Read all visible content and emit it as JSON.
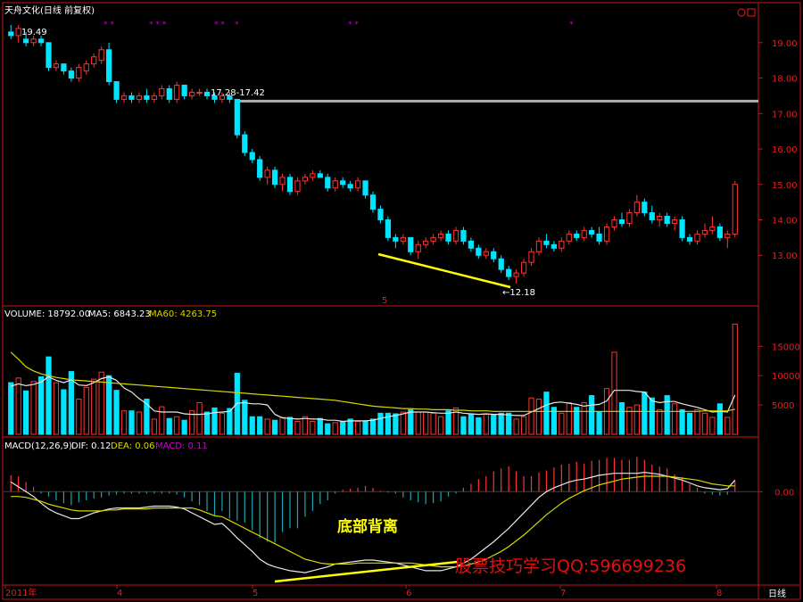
{
  "window": {
    "title": "天舟文化(日线 前复权)",
    "period_button": "日线",
    "zoom_icon": "circle-icon"
  },
  "colors": {
    "up": "#ff3333",
    "down": "#00e5ff",
    "frame": "#c81414",
    "ma_yellow": "#d8d800",
    "ma_white": "#e8e8e8",
    "highlight": "#ffff00",
    "macd_label": "#d000d0",
    "watermark": "#e01010"
  },
  "price_panel": {
    "high_note": "19.49",
    "range_note": "17.28-17.42",
    "low_note": "←12.18",
    "marker_5": "5"
  },
  "volume_panel": {
    "label": "VOLUME: 18792.00",
    "ma5": "MA5: 6843.23",
    "ma60": "MA60: 4263.75"
  },
  "macd_panel": {
    "label": "MACD(12,26,9)",
    "dif": "DIF: 0.12",
    "dea": "DEA: 0.06",
    "macd": "MACD: 0.11"
  },
  "annotations": {
    "divergence": "底部背离",
    "watermark": "股票技巧学习QQ:596699236"
  },
  "x_axis_labels": [
    "2011年",
    "4",
    "5",
    "6",
    "7",
    "8"
  ],
  "chart_data": [
    {
      "type": "candlestick",
      "name": "price",
      "y_ticks": [
        13.0,
        14.0,
        15.0,
        16.0,
        17.0,
        18.0,
        19.0
      ],
      "ylim": [
        12.1,
        19.7
      ],
      "resistance": 17.35,
      "ohlc": [
        [
          19.3,
          19.5,
          19.1,
          19.2
        ],
        [
          19.2,
          19.5,
          19.0,
          19.4
        ],
        [
          19.1,
          19.3,
          18.9,
          19.0
        ],
        [
          19.0,
          19.2,
          18.9,
          19.1
        ],
        [
          19.1,
          19.2,
          18.9,
          19.0
        ],
        [
          19.0,
          19.0,
          18.2,
          18.3
        ],
        [
          18.3,
          18.5,
          18.2,
          18.4
        ],
        [
          18.4,
          18.4,
          18.1,
          18.2
        ],
        [
          18.2,
          18.3,
          17.9,
          18.0
        ],
        [
          18.0,
          18.4,
          17.9,
          18.3
        ],
        [
          18.2,
          18.5,
          18.1,
          18.4
        ],
        [
          18.4,
          18.7,
          18.3,
          18.6
        ],
        [
          18.5,
          18.9,
          18.4,
          18.8
        ],
        [
          18.8,
          19.0,
          17.8,
          17.9
        ],
        [
          17.9,
          17.9,
          17.3,
          17.4
        ],
        [
          17.4,
          17.6,
          17.3,
          17.5
        ],
        [
          17.5,
          17.6,
          17.3,
          17.4
        ],
        [
          17.4,
          17.6,
          17.3,
          17.5
        ],
        [
          17.5,
          17.7,
          17.3,
          17.4
        ],
        [
          17.4,
          17.6,
          17.3,
          17.5
        ],
        [
          17.5,
          17.8,
          17.4,
          17.7
        ],
        [
          17.7,
          17.8,
          17.3,
          17.4
        ],
        [
          17.4,
          17.9,
          17.3,
          17.8
        ],
        [
          17.8,
          17.8,
          17.4,
          17.5
        ],
        [
          17.5,
          17.7,
          17.4,
          17.6
        ],
        [
          17.6,
          17.7,
          17.5,
          17.6
        ],
        [
          17.6,
          17.7,
          17.4,
          17.5
        ],
        [
          17.5,
          17.6,
          17.3,
          17.4
        ],
        [
          17.4,
          17.6,
          17.3,
          17.5
        ],
        [
          17.5,
          17.6,
          17.3,
          17.4
        ],
        [
          17.4,
          17.4,
          16.3,
          16.4
        ],
        [
          16.4,
          16.5,
          15.8,
          15.9
        ],
        [
          15.9,
          16.0,
          15.6,
          15.7
        ],
        [
          15.7,
          15.8,
          15.1,
          15.2
        ],
        [
          15.2,
          15.5,
          15.0,
          15.4
        ],
        [
          15.4,
          15.5,
          14.9,
          15.0
        ],
        [
          15.0,
          15.3,
          14.8,
          15.2
        ],
        [
          15.2,
          15.3,
          14.7,
          14.8
        ],
        [
          14.8,
          15.2,
          14.7,
          15.1
        ],
        [
          15.1,
          15.3,
          15.0,
          15.2
        ],
        [
          15.2,
          15.4,
          15.1,
          15.3
        ],
        [
          15.3,
          15.4,
          15.2,
          15.2
        ],
        [
          15.2,
          15.3,
          14.8,
          14.9
        ],
        [
          14.9,
          15.2,
          14.8,
          15.1
        ],
        [
          15.1,
          15.2,
          14.9,
          15.0
        ],
        [
          15.0,
          15.1,
          14.8,
          14.9
        ],
        [
          14.9,
          15.2,
          14.8,
          15.1
        ],
        [
          15.1,
          15.1,
          14.6,
          14.7
        ],
        [
          14.7,
          14.8,
          14.2,
          14.3
        ],
        [
          14.3,
          14.4,
          13.9,
          14.0
        ],
        [
          14.0,
          14.1,
          13.4,
          13.5
        ],
        [
          13.5,
          13.6,
          13.2,
          13.4
        ],
        [
          13.4,
          13.6,
          13.3,
          13.5
        ],
        [
          13.5,
          13.5,
          13.0,
          13.1
        ],
        [
          13.1,
          13.4,
          12.9,
          13.3
        ],
        [
          13.3,
          13.5,
          13.2,
          13.4
        ],
        [
          13.4,
          13.6,
          13.3,
          13.5
        ],
        [
          13.5,
          13.7,
          13.4,
          13.6
        ],
        [
          13.6,
          13.7,
          13.3,
          13.4
        ],
        [
          13.4,
          13.8,
          13.3,
          13.7
        ],
        [
          13.7,
          13.8,
          13.3,
          13.4
        ],
        [
          13.4,
          13.5,
          13.1,
          13.2
        ],
        [
          13.2,
          13.3,
          12.9,
          13.0
        ],
        [
          13.0,
          13.2,
          12.9,
          13.1
        ],
        [
          13.1,
          13.2,
          12.8,
          12.9
        ],
        [
          12.9,
          13.0,
          12.5,
          12.6
        ],
        [
          12.6,
          12.7,
          12.3,
          12.4
        ],
        [
          12.4,
          12.6,
          12.2,
          12.5
        ],
        [
          12.5,
          12.9,
          12.4,
          12.8
        ],
        [
          12.8,
          13.2,
          12.7,
          13.1
        ],
        [
          13.1,
          13.5,
          13.0,
          13.4
        ],
        [
          13.4,
          13.6,
          13.2,
          13.3
        ],
        [
          13.3,
          13.4,
          13.1,
          13.2
        ],
        [
          13.2,
          13.5,
          13.1,
          13.4
        ],
        [
          13.4,
          13.7,
          13.3,
          13.6
        ],
        [
          13.6,
          13.7,
          13.4,
          13.5
        ],
        [
          13.5,
          13.8,
          13.4,
          13.7
        ],
        [
          13.7,
          13.8,
          13.5,
          13.6
        ],
        [
          13.6,
          13.8,
          13.3,
          13.4
        ],
        [
          13.4,
          13.9,
          13.3,
          13.8
        ],
        [
          13.8,
          14.1,
          13.7,
          14.0
        ],
        [
          14.0,
          14.2,
          13.8,
          13.9
        ],
        [
          13.9,
          14.3,
          13.8,
          14.2
        ],
        [
          14.2,
          14.7,
          14.1,
          14.5
        ],
        [
          14.5,
          14.6,
          14.1,
          14.2
        ],
        [
          14.2,
          14.4,
          13.9,
          14.0
        ],
        [
          14.0,
          14.2,
          13.8,
          14.1
        ],
        [
          14.1,
          14.2,
          13.8,
          13.9
        ],
        [
          13.9,
          14.1,
          13.7,
          14.0
        ],
        [
          14.0,
          14.1,
          13.4,
          13.5
        ],
        [
          13.5,
          13.6,
          13.3,
          13.4
        ],
        [
          13.4,
          13.7,
          13.3,
          13.6
        ],
        [
          13.6,
          13.9,
          13.5,
          13.7
        ],
        [
          13.7,
          14.1,
          13.6,
          13.8
        ],
        [
          13.8,
          13.9,
          13.4,
          13.5
        ],
        [
          13.5,
          13.7,
          13.2,
          13.6
        ],
        [
          13.6,
          15.1,
          13.5,
          15.0
        ]
      ]
    },
    {
      "type": "bar",
      "name": "volume",
      "y_ticks": [
        5000,
        10000,
        15000
      ],
      "ylim": [
        0,
        19000
      ],
      "values": [
        8800,
        9600,
        7400,
        9000,
        9800,
        13200,
        8800,
        7600,
        10700,
        6000,
        8000,
        9400,
        10600,
        10000,
        7500,
        4000,
        4000,
        3800,
        6000,
        2600,
        4700,
        2700,
        3000,
        2400,
        4000,
        5400,
        3800,
        4500,
        3600,
        4400,
        10400,
        5800,
        3000,
        3000,
        2600,
        2400,
        2900,
        2900,
        2200,
        3000,
        2200,
        2700,
        1800,
        2000,
        2200,
        2600,
        2200,
        2300,
        2600,
        3600,
        3600,
        3500,
        3800,
        4200,
        3800,
        3800,
        3600,
        3000,
        4000,
        4500,
        3000,
        3500,
        2800,
        3400,
        3300,
        3600,
        3600,
        2600,
        3000,
        6200,
        6000,
        7200,
        4600,
        3600,
        5400,
        4600,
        5400,
        6600,
        3800,
        7800,
        14000,
        5400,
        4600,
        5000,
        7200,
        6200,
        4200,
        6600,
        5200,
        4200,
        3600,
        4200,
        3600,
        2900,
        5200,
        2900,
        18792
      ],
      "ma5": [
        8200,
        8600,
        8300,
        8500,
        8900,
        9800,
        9200,
        8800,
        9300,
        8400,
        8300,
        8800,
        9500,
        9800,
        9200,
        7900,
        7200,
        6100,
        5200,
        4000,
        3800,
        3800,
        3800,
        3500,
        3400,
        3400,
        3500,
        3700,
        3800,
        3900,
        5300,
        5400,
        5200,
        5200,
        5000,
        3400,
        2800,
        2700,
        2600,
        2700,
        2600,
        2600,
        2400,
        2400,
        2200,
        2300,
        2300,
        2300,
        2400,
        2700,
        3000,
        3200,
        3500,
        3800,
        3800,
        3800,
        3700,
        3600,
        3600,
        3800,
        3600,
        3500,
        3400,
        3500,
        3400,
        3400,
        3300,
        3200,
        3200,
        3800,
        4400,
        5000,
        5400,
        5500,
        5300,
        5100,
        4800,
        5000,
        5100,
        5700,
        7500,
        7500,
        7500,
        7300,
        7200,
        5700,
        5400,
        5600,
        5600,
        5200,
        4900,
        4600,
        4200,
        3800,
        3900,
        3800,
        6700
      ],
      "ma60": [
        14000,
        12800,
        11500,
        10800,
        10300,
        10000,
        9700,
        9500,
        9300,
        9200,
        9100,
        9000,
        8900,
        8800,
        8700,
        8600,
        8500,
        8400,
        8300,
        8200,
        8100,
        8000,
        7900,
        7800,
        7700,
        7600,
        7500,
        7400,
        7300,
        7200,
        7100,
        7000,
        6900,
        6800,
        6700,
        6600,
        6500,
        6400,
        6300,
        6200,
        6100,
        6000,
        5900,
        5800,
        5600,
        5400,
        5200,
        5000,
        4800,
        4700,
        4600,
        4500,
        4400,
        4400,
        4300,
        4300,
        4200,
        4200,
        4200,
        4100,
        4100,
        4000,
        4000,
        4000,
        3900,
        3900,
        3900,
        3900,
        3900,
        3900,
        3900,
        3900,
        3900,
        3900,
        3900,
        3900,
        3900,
        3900,
        3900,
        3900,
        3900,
        3900,
        3900,
        3900,
        3900,
        3900,
        3900,
        3900,
        3900,
        3900,
        3900,
        3900,
        4000,
        4000,
        4000,
        4000,
        4263.75
      ]
    },
    {
      "type": "bar",
      "name": "macd",
      "y_ticks": [
        0.0
      ],
      "ylim": [
        -0.95,
        0.4
      ],
      "histogram": [
        0.17,
        0.16,
        0.1,
        0.05,
        -0.02,
        -0.05,
        -0.09,
        -0.12,
        -0.14,
        -0.11,
        -0.09,
        -0.07,
        -0.06,
        -0.04,
        -0.03,
        -0.02,
        -0.02,
        -0.02,
        -0.02,
        -0.02,
        -0.02,
        -0.02,
        -0.03,
        -0.06,
        -0.1,
        -0.14,
        -0.2,
        -0.25,
        -0.2,
        -0.28,
        -0.3,
        -0.32,
        -0.4,
        -0.48,
        -0.52,
        -0.53,
        -0.42,
        -0.38,
        -0.38,
        -0.26,
        -0.2,
        -0.13,
        -0.09,
        -0.02,
        0.02,
        0.03,
        0.04,
        0.06,
        0.04,
        0.01,
        -0.01,
        -0.02,
        -0.06,
        -0.09,
        -0.11,
        -0.13,
        -0.12,
        -0.1,
        -0.05,
        -0.02,
        0.04,
        0.08,
        0.13,
        0.16,
        0.21,
        0.24,
        0.26,
        0.21,
        0.16,
        0.16,
        0.2,
        0.22,
        0.25,
        0.28,
        0.29,
        0.31,
        0.29,
        0.32,
        0.33,
        0.35,
        0.35,
        0.33,
        0.33,
        0.36,
        0.33,
        0.28,
        0.26,
        0.24,
        0.18,
        0.15,
        0.08,
        0.04,
        -0.02,
        -0.03,
        -0.04,
        -0.03,
        0.11
      ],
      "dif": [
        0.1,
        0.05,
        0.0,
        -0.05,
        -0.12,
        -0.18,
        -0.22,
        -0.25,
        -0.28,
        -0.28,
        -0.25,
        -0.22,
        -0.2,
        -0.18,
        -0.17,
        -0.17,
        -0.17,
        -0.17,
        -0.16,
        -0.15,
        -0.15,
        -0.15,
        -0.16,
        -0.18,
        -0.22,
        -0.26,
        -0.3,
        -0.34,
        -0.33,
        -0.4,
        -0.48,
        -0.55,
        -0.62,
        -0.7,
        -0.75,
        -0.78,
        -0.8,
        -0.82,
        -0.83,
        -0.84,
        -0.82,
        -0.8,
        -0.78,
        -0.75,
        -0.74,
        -0.73,
        -0.72,
        -0.71,
        -0.71,
        -0.72,
        -0.73,
        -0.74,
        -0.76,
        -0.78,
        -0.8,
        -0.82,
        -0.82,
        -0.82,
        -0.8,
        -0.78,
        -0.74,
        -0.7,
        -0.64,
        -0.58,
        -0.52,
        -0.45,
        -0.38,
        -0.3,
        -0.22,
        -0.14,
        -0.06,
        0.0,
        0.04,
        0.07,
        0.1,
        0.12,
        0.13,
        0.15,
        0.17,
        0.18,
        0.19,
        0.19,
        0.19,
        0.19,
        0.2,
        0.19,
        0.18,
        0.16,
        0.14,
        0.12,
        0.09,
        0.06,
        0.04,
        0.03,
        0.02,
        0.03,
        0.12
      ],
      "dea": [
        -0.05,
        -0.05,
        -0.06,
        -0.08,
        -0.1,
        -0.13,
        -0.15,
        -0.17,
        -0.19,
        -0.2,
        -0.2,
        -0.2,
        -0.2,
        -0.19,
        -0.19,
        -0.18,
        -0.18,
        -0.18,
        -0.18,
        -0.17,
        -0.17,
        -0.17,
        -0.17,
        -0.17,
        -0.17,
        -0.19,
        -0.22,
        -0.25,
        -0.26,
        -0.3,
        -0.34,
        -0.38,
        -0.42,
        -0.46,
        -0.5,
        -0.54,
        -0.58,
        -0.62,
        -0.66,
        -0.7,
        -0.72,
        -0.74,
        -0.75,
        -0.75,
        -0.75,
        -0.75,
        -0.74,
        -0.74,
        -0.74,
        -0.74,
        -0.74,
        -0.74,
        -0.74,
        -0.74,
        -0.75,
        -0.76,
        -0.77,
        -0.78,
        -0.78,
        -0.78,
        -0.77,
        -0.75,
        -0.73,
        -0.7,
        -0.66,
        -0.62,
        -0.57,
        -0.51,
        -0.45,
        -0.38,
        -0.31,
        -0.24,
        -0.18,
        -0.12,
        -0.07,
        -0.03,
        0.01,
        0.04,
        0.07,
        0.09,
        0.11,
        0.13,
        0.14,
        0.15,
        0.16,
        0.16,
        0.16,
        0.16,
        0.15,
        0.14,
        0.13,
        0.12,
        0.1,
        0.08,
        0.07,
        0.06,
        0.06
      ]
    }
  ]
}
